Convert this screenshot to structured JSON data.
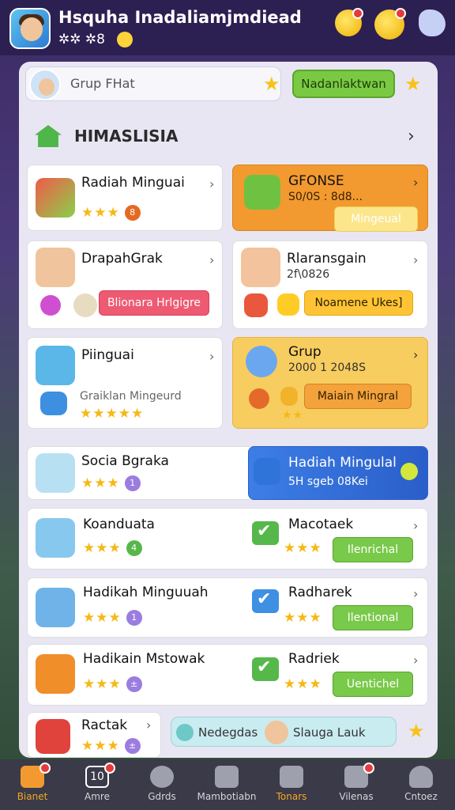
{
  "header": {
    "title": "Hsquha Inadaliamjmdiead",
    "subtitle": "✲✲ ✲8"
  },
  "panel": {
    "search_label": "Grup FHat",
    "action_button": "Nadanlaktwan",
    "section_title": "HIMASLISIA"
  },
  "cards": [
    {
      "title": "Radiah Minguai",
      "badge": "8",
      "stars": "★★★"
    },
    {
      "title": "GFONSE",
      "sub": "S0/0S : 8d8...",
      "button": "Mingeual"
    },
    {
      "title": "DrapahGrak",
      "button": "Blionara Hrlgigre"
    },
    {
      "title": "Rlaransgain",
      "sub": "2f\\0826",
      "button": "Noamene Ukes]"
    },
    {
      "title": "Piinguai",
      "sub": "Graiklan Mingeurd",
      "stars": "★★★★★"
    },
    {
      "title": "Grup",
      "sub": "2000 1 2048S",
      "button": "Maiain Mingral",
      "stars": "★★"
    },
    {
      "title": "Socia Bgraka",
      "badge": "1",
      "stars": "★★★"
    },
    {
      "title": "Hadiah Mingulal",
      "sub": "5H sgeb 08Kei"
    },
    {
      "title": "Koanduata",
      "badge": "4",
      "stars": "★★★"
    },
    {
      "title": "Macotaek",
      "button": "Ilenrichal",
      "stars": "★★★"
    },
    {
      "title": "Hadikah Minguuah",
      "badge": "1",
      "stars": "★★★"
    },
    {
      "title": "Radharek",
      "button": "Ilentional",
      "stars": "★★★"
    },
    {
      "title": "Hadikain Mstowak",
      "badge": "±",
      "stars": "★★★"
    },
    {
      "title": "Radriek",
      "button": "Uentichel",
      "stars": "★★★"
    },
    {
      "title": "Ractak",
      "badge": "±",
      "stars": "★★★"
    }
  ],
  "bottom_pill": {
    "left": "Nedegdas",
    "right": "Slauga Lauk"
  },
  "nav": [
    {
      "label": "Bianet"
    },
    {
      "label": "Amre",
      "icon_text": "10"
    },
    {
      "label": "Gdrds"
    },
    {
      "label": "Mambotiabn"
    },
    {
      "label": "Tonars"
    },
    {
      "label": "Vilenas"
    },
    {
      "label": "Cntoez"
    }
  ]
}
